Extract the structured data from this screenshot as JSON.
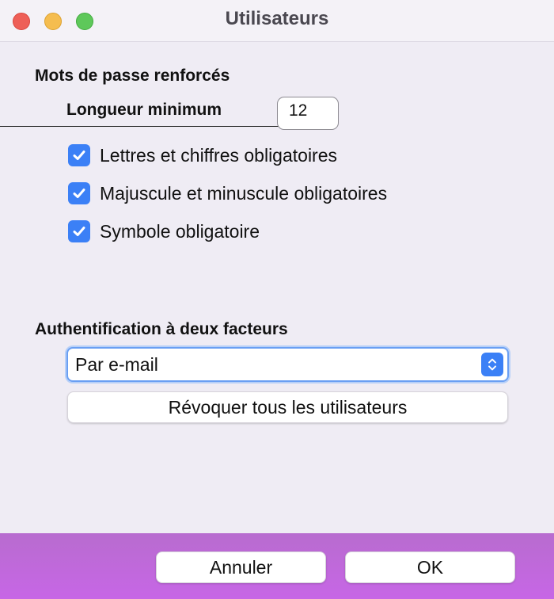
{
  "window": {
    "title": "Utilisateurs",
    "controls": [
      "close",
      "minimize",
      "zoom"
    ]
  },
  "password_section": {
    "heading": "Mots de passe renforcés",
    "min_length_label": "Longueur minimum",
    "min_length_value": "12",
    "options": [
      {
        "label": "Lettres et chiffres obligatoires",
        "checked": true
      },
      {
        "label": "Majuscule et minuscule obligatoires",
        "checked": true
      },
      {
        "label": "Symbole obligatoire",
        "checked": true
      }
    ]
  },
  "twofa_section": {
    "heading": "Authentification à deux facteurs",
    "method_selected": "Par e-mail",
    "revoke_label": "Révoquer tous les utilisateurs"
  },
  "footer": {
    "cancel_label": "Annuler",
    "ok_label": "OK"
  },
  "colors": {
    "accent": "#3b80f6",
    "footer_gradient_start": "#b86ccf",
    "footer_gradient_end": "#c766e6",
    "window_bg": "#efecf4"
  }
}
